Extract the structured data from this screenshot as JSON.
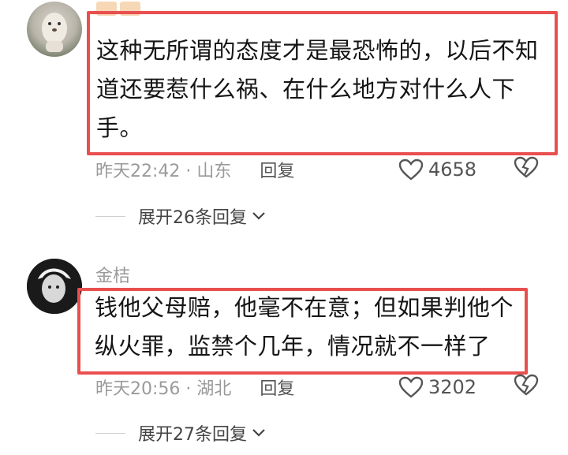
{
  "comments": [
    {
      "username": "",
      "text": "这种无所谓的态度才是最恐怖的，以后不知道还要惹什么祸、在什么地方对什么人下手。",
      "time_location": "昨天22:42 · 山东",
      "reply_label": "回复",
      "likes": "4658",
      "expand_label": "展开26条回复"
    },
    {
      "username": "金桔",
      "text": "钱他父母赔，他毫不在意；但如果判他个纵火罪，监禁个几年，情况就不一样了",
      "time_location": "昨天20:56 · 湖北",
      "reply_label": "回复",
      "likes": "3202",
      "expand_label": "展开27条回复"
    }
  ],
  "colors": {
    "highlight_box": "#e94f4f",
    "muted_text": "#9a9a9a",
    "body_text": "#151515"
  },
  "icons": [
    "heart-icon",
    "broken-heart-icon",
    "chevron-down-icon"
  ]
}
